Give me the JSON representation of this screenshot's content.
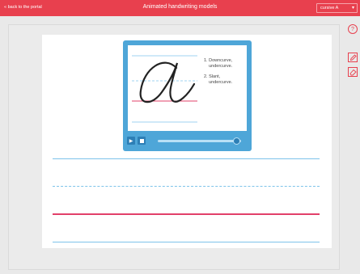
{
  "header": {
    "back_label": "« back to the portal",
    "title": "Animated handwriting models",
    "style_select": "cursive A"
  },
  "tools": {
    "help_glyph": "?"
  },
  "player": {
    "steps": [
      "1. Downcurve,\n    undercurve.",
      "2. Slant,\n    undercurve."
    ],
    "progress": 0.95
  },
  "colors": {
    "brand_red": "#e8404e",
    "player_blue": "#4ea6d8",
    "guide_blue": "#7ec3ea",
    "guide_red": "#e2406a"
  }
}
